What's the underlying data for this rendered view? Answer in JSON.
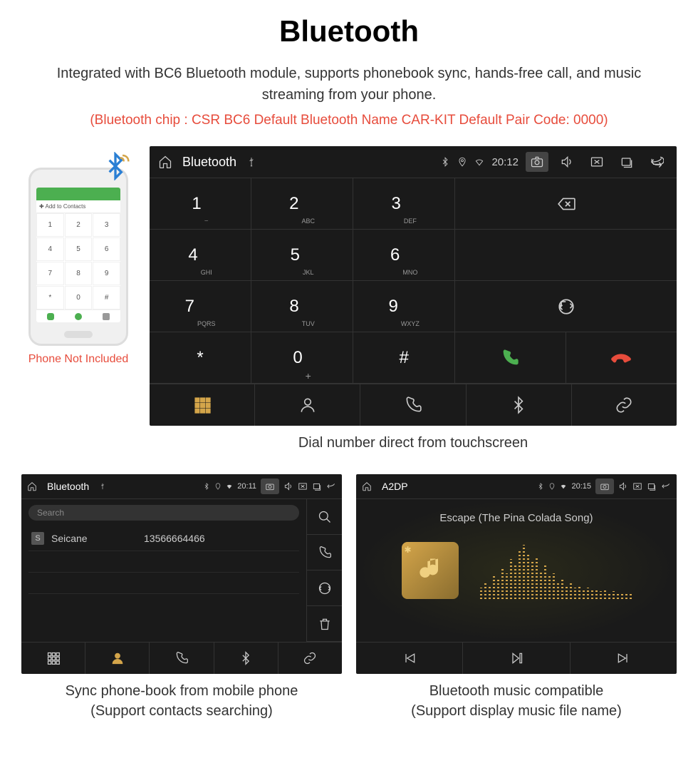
{
  "title": "Bluetooth",
  "subtitle": "Integrated with BC6 Bluetooth module, supports phonebook sync, hands-free call, and music streaming from your phone.",
  "specs": "(Bluetooth chip : CSR BC6     Default Bluetooth Name CAR-KIT     Default Pair Code: 0000)",
  "phone_caption": "Phone Not Included",
  "phone_addbar": "✚  Add to Contacts",
  "dialer": {
    "status_title": "Bluetooth",
    "time": "20:12",
    "keys": [
      {
        "num": "1",
        "sub": "⌣"
      },
      {
        "num": "2",
        "sub": "ABC"
      },
      {
        "num": "3",
        "sub": "DEF"
      },
      {
        "num": "4",
        "sub": "GHI"
      },
      {
        "num": "5",
        "sub": "JKL"
      },
      {
        "num": "6",
        "sub": "MNO"
      },
      {
        "num": "7",
        "sub": "PQRS"
      },
      {
        "num": "8",
        "sub": "TUV"
      },
      {
        "num": "9",
        "sub": "WXYZ"
      },
      {
        "num": "*",
        "sub": ""
      },
      {
        "num": "0",
        "sub": "+"
      },
      {
        "num": "#",
        "sub": ""
      }
    ],
    "caption": "Dial number direct from touchscreen"
  },
  "contacts": {
    "status_title": "Bluetooth",
    "time": "20:11",
    "search_placeholder": "Search",
    "badge": "S",
    "name": "Seicane",
    "number": "13566664466",
    "caption_l1": "Sync phone-book from mobile phone",
    "caption_l2": "(Support contacts searching)"
  },
  "music": {
    "status_title": "A2DP",
    "time": "20:15",
    "track": "Escape (The Pina Colada Song)",
    "caption_l1": "Bluetooth music compatible",
    "caption_l2": "(Support display music file name)"
  }
}
